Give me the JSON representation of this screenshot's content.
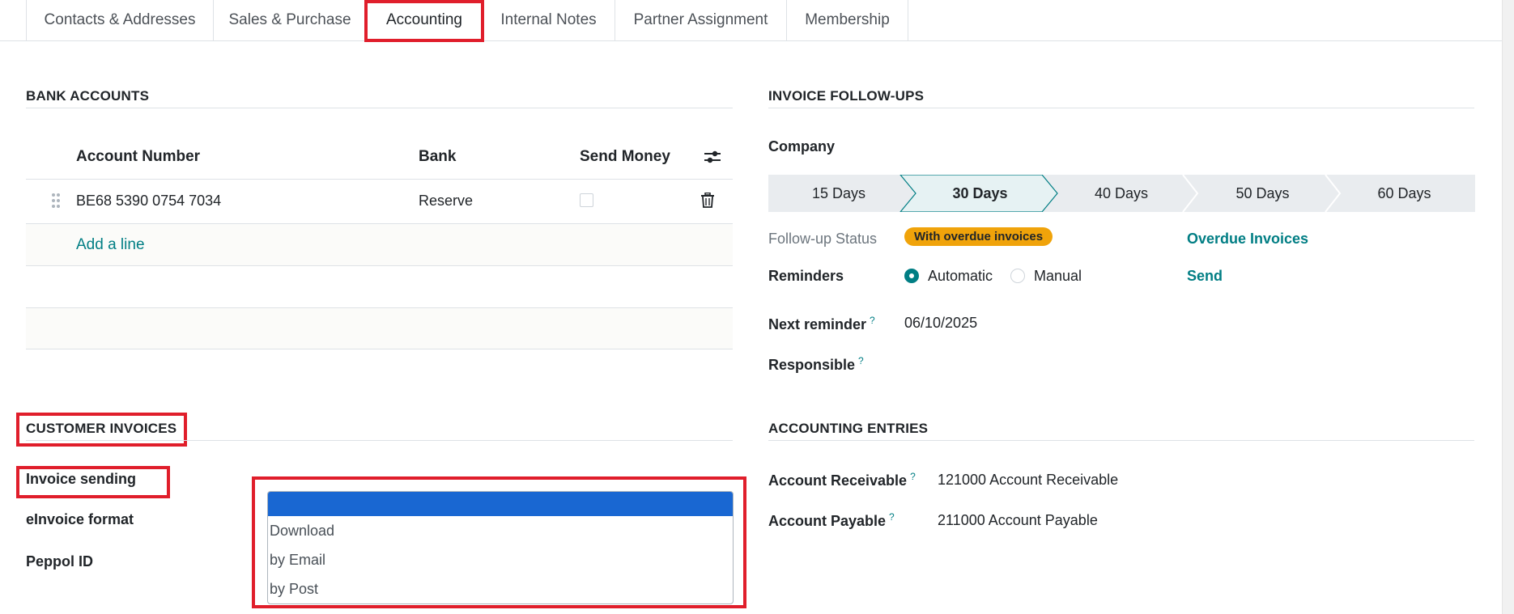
{
  "tabs": [
    {
      "label": "Contacts & Addresses"
    },
    {
      "label": "Sales & Purchase"
    },
    {
      "label": "Accounting"
    },
    {
      "label": "Internal Notes"
    },
    {
      "label": "Partner Assignment"
    },
    {
      "label": "Membership"
    }
  ],
  "bank_accounts": {
    "title": "BANK ACCOUNTS",
    "columns": {
      "account_number": "Account Number",
      "bank": "Bank",
      "send_money": "Send Money"
    },
    "rows": [
      {
        "account_number": "BE68 5390 0754 7034",
        "bank": "Reserve"
      }
    ],
    "add_line": "Add a line"
  },
  "customer_invoices": {
    "title": "CUSTOMER INVOICES",
    "invoice_sending_label": "Invoice sending",
    "einvoice_format_label": "eInvoice format",
    "peppol_id_label": "Peppol ID",
    "dropdown_options": [
      "Download",
      "by Email",
      "by Post"
    ]
  },
  "followups": {
    "title": "INVOICE FOLLOW-UPS",
    "company_label": "Company",
    "stages": [
      "15 Days",
      "30 Days",
      "40 Days",
      "50 Days",
      "60 Days"
    ],
    "active_stage": "30 Days",
    "status_label": "Follow-up Status",
    "status_badge": "With overdue invoices",
    "overdue_link": "Overdue Invoices",
    "reminders_label": "Reminders",
    "reminder_automatic": "Automatic",
    "reminder_manual": "Manual",
    "send_link": "Send",
    "next_reminder_label": "Next reminder",
    "next_reminder_value": "06/10/2025",
    "responsible_label": "Responsible",
    "help_mark": "?"
  },
  "accounting_entries": {
    "title": "ACCOUNTING ENTRIES",
    "receivable_label": "Account Receivable",
    "receivable_value": "121000 Account Receivable",
    "payable_label": "Account Payable",
    "payable_value": "211000 Account Payable"
  },
  "colors": {
    "accent": "#017e84",
    "highlight": "#e01e2b",
    "badge": "#f0a30a",
    "dropdown_selected": "#1967d2"
  }
}
